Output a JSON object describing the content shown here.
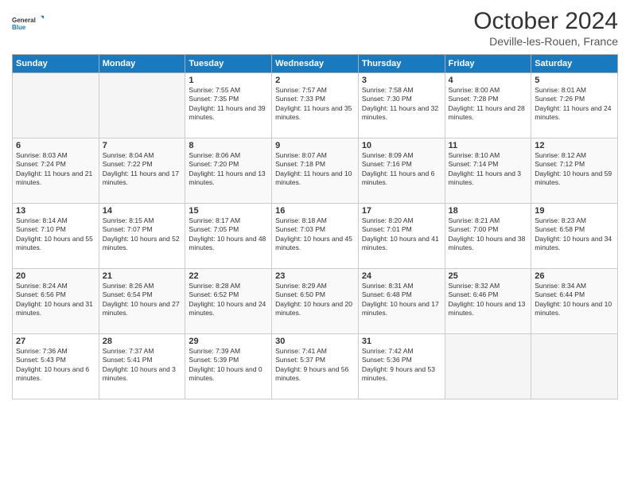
{
  "header": {
    "logo_general": "General",
    "logo_blue": "Blue",
    "month_title": "October 2024",
    "subtitle": "Deville-les-Rouen, France"
  },
  "days_of_week": [
    "Sunday",
    "Monday",
    "Tuesday",
    "Wednesday",
    "Thursday",
    "Friday",
    "Saturday"
  ],
  "weeks": [
    [
      {
        "day": "",
        "empty": true
      },
      {
        "day": "",
        "empty": true
      },
      {
        "day": "1",
        "sunrise": "7:55 AM",
        "sunset": "7:35 PM",
        "daylight": "11 hours and 39 minutes."
      },
      {
        "day": "2",
        "sunrise": "7:57 AM",
        "sunset": "7:33 PM",
        "daylight": "11 hours and 35 minutes."
      },
      {
        "day": "3",
        "sunrise": "7:58 AM",
        "sunset": "7:30 PM",
        "daylight": "11 hours and 32 minutes."
      },
      {
        "day": "4",
        "sunrise": "8:00 AM",
        "sunset": "7:28 PM",
        "daylight": "11 hours and 28 minutes."
      },
      {
        "day": "5",
        "sunrise": "8:01 AM",
        "sunset": "7:26 PM",
        "daylight": "11 hours and 24 minutes."
      }
    ],
    [
      {
        "day": "6",
        "sunrise": "8:03 AM",
        "sunset": "7:24 PM",
        "daylight": "11 hours and 21 minutes."
      },
      {
        "day": "7",
        "sunrise": "8:04 AM",
        "sunset": "7:22 PM",
        "daylight": "11 hours and 17 minutes."
      },
      {
        "day": "8",
        "sunrise": "8:06 AM",
        "sunset": "7:20 PM",
        "daylight": "11 hours and 13 minutes."
      },
      {
        "day": "9",
        "sunrise": "8:07 AM",
        "sunset": "7:18 PM",
        "daylight": "11 hours and 10 minutes."
      },
      {
        "day": "10",
        "sunrise": "8:09 AM",
        "sunset": "7:16 PM",
        "daylight": "11 hours and 6 minutes."
      },
      {
        "day": "11",
        "sunrise": "8:10 AM",
        "sunset": "7:14 PM",
        "daylight": "11 hours and 3 minutes."
      },
      {
        "day": "12",
        "sunrise": "8:12 AM",
        "sunset": "7:12 PM",
        "daylight": "10 hours and 59 minutes."
      }
    ],
    [
      {
        "day": "13",
        "sunrise": "8:14 AM",
        "sunset": "7:10 PM",
        "daylight": "10 hours and 55 minutes."
      },
      {
        "day": "14",
        "sunrise": "8:15 AM",
        "sunset": "7:07 PM",
        "daylight": "10 hours and 52 minutes."
      },
      {
        "day": "15",
        "sunrise": "8:17 AM",
        "sunset": "7:05 PM",
        "daylight": "10 hours and 48 minutes."
      },
      {
        "day": "16",
        "sunrise": "8:18 AM",
        "sunset": "7:03 PM",
        "daylight": "10 hours and 45 minutes."
      },
      {
        "day": "17",
        "sunrise": "8:20 AM",
        "sunset": "7:01 PM",
        "daylight": "10 hours and 41 minutes."
      },
      {
        "day": "18",
        "sunrise": "8:21 AM",
        "sunset": "7:00 PM",
        "daylight": "10 hours and 38 minutes."
      },
      {
        "day": "19",
        "sunrise": "8:23 AM",
        "sunset": "6:58 PM",
        "daylight": "10 hours and 34 minutes."
      }
    ],
    [
      {
        "day": "20",
        "sunrise": "8:24 AM",
        "sunset": "6:56 PM",
        "daylight": "10 hours and 31 minutes."
      },
      {
        "day": "21",
        "sunrise": "8:26 AM",
        "sunset": "6:54 PM",
        "daylight": "10 hours and 27 minutes."
      },
      {
        "day": "22",
        "sunrise": "8:28 AM",
        "sunset": "6:52 PM",
        "daylight": "10 hours and 24 minutes."
      },
      {
        "day": "23",
        "sunrise": "8:29 AM",
        "sunset": "6:50 PM",
        "daylight": "10 hours and 20 minutes."
      },
      {
        "day": "24",
        "sunrise": "8:31 AM",
        "sunset": "6:48 PM",
        "daylight": "10 hours and 17 minutes."
      },
      {
        "day": "25",
        "sunrise": "8:32 AM",
        "sunset": "6:46 PM",
        "daylight": "10 hours and 13 minutes."
      },
      {
        "day": "26",
        "sunrise": "8:34 AM",
        "sunset": "6:44 PM",
        "daylight": "10 hours and 10 minutes."
      }
    ],
    [
      {
        "day": "27",
        "sunrise": "7:36 AM",
        "sunset": "5:43 PM",
        "daylight": "10 hours and 6 minutes."
      },
      {
        "day": "28",
        "sunrise": "7:37 AM",
        "sunset": "5:41 PM",
        "daylight": "10 hours and 3 minutes."
      },
      {
        "day": "29",
        "sunrise": "7:39 AM",
        "sunset": "5:39 PM",
        "daylight": "10 hours and 0 minutes."
      },
      {
        "day": "30",
        "sunrise": "7:41 AM",
        "sunset": "5:37 PM",
        "daylight": "9 hours and 56 minutes."
      },
      {
        "day": "31",
        "sunrise": "7:42 AM",
        "sunset": "5:36 PM",
        "daylight": "9 hours and 53 minutes."
      },
      {
        "day": "",
        "empty": true
      },
      {
        "day": "",
        "empty": true
      }
    ]
  ]
}
